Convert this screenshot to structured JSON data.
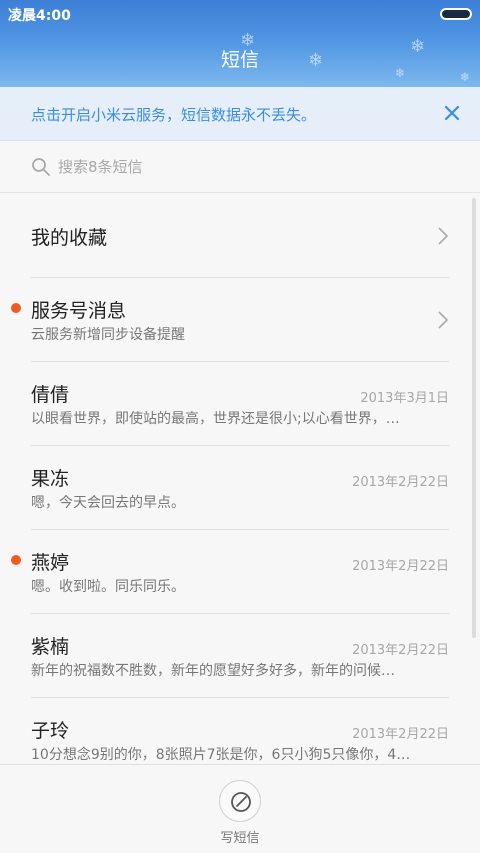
{
  "status_bar": {
    "time": "凌晨4:00"
  },
  "header": {
    "title": "短信"
  },
  "notice": {
    "text": "点击开启小米云服务，短信数据永不丢失。"
  },
  "search": {
    "placeholder": "搜索8条短信"
  },
  "conversations": [
    {
      "name": "我的收藏",
      "preview": "",
      "date": "",
      "unread": false,
      "chevron": true
    },
    {
      "name": "服务号消息",
      "preview": "云服务新增同步设备提醒",
      "date": "",
      "unread": true,
      "chevron": true
    },
    {
      "name": "倩倩",
      "preview": "以眼看世界，即使站的最高，世界还是很小;以心看世界，…",
      "date": "2013年3月1日",
      "unread": false,
      "chevron": false
    },
    {
      "name": "果冻",
      "preview": "嗯，今天会回去的早点。",
      "date": "2013年2月22日",
      "unread": false,
      "chevron": false
    },
    {
      "name": "燕婷",
      "preview": "嗯。收到啦。同乐同乐。",
      "date": "2013年2月22日",
      "unread": true,
      "chevron": false
    },
    {
      "name": "紫楠",
      "preview": "新年的祝福数不胜数，新年的愿望好多好多，新年的问候…",
      "date": "2013年2月22日",
      "unread": false,
      "chevron": false
    },
    {
      "name": "子玲",
      "preview": "10分想念9别的你，8张照片7张是你，6只小狗5只像你，4…",
      "date": "2013年2月22日",
      "unread": false,
      "chevron": false
    }
  ],
  "bottom": {
    "compose_label": "写短信"
  },
  "colors": {
    "accent": "#3a8de0",
    "unread_dot": "#f15a22"
  }
}
